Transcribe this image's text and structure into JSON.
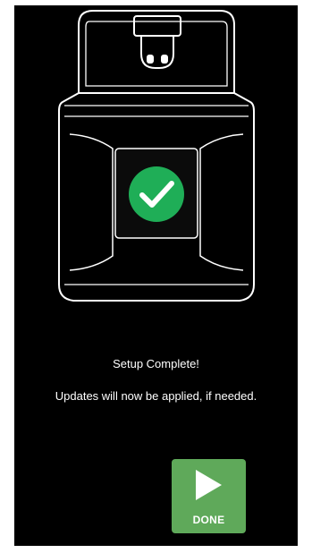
{
  "setup": {
    "title": "Setup Complete!",
    "message": "Updates will now be applied, if needed."
  },
  "done_button": {
    "label": "DONE",
    "icon": "play-icon"
  },
  "device": {
    "status_icon": "checkmark-icon"
  },
  "colors": {
    "background": "#000000",
    "success": "#1fae57",
    "button": "#5fa95a",
    "outline": "#ffffff"
  }
}
